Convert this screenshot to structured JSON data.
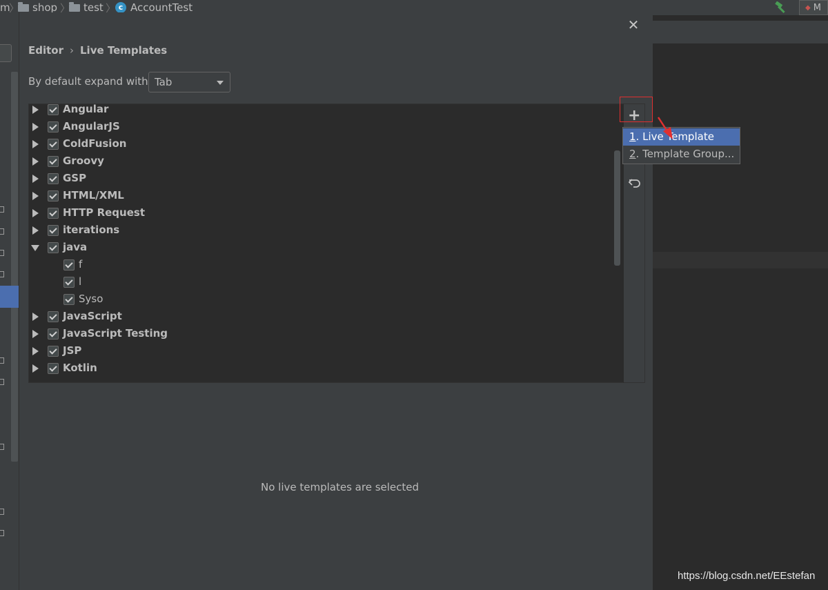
{
  "topbar": {
    "crumb_m": "m",
    "crumb_shop": "shop",
    "crumb_test": "test",
    "crumb_file": "AccountTest",
    "file_icon_letter": "c",
    "run_config": "M"
  },
  "dialog": {
    "breadcrumb_editor": "Editor",
    "breadcrumb_arrow": "›",
    "breadcrumb_page": "Live Templates",
    "close_glyph": "✕",
    "expand_label": "By default expand with",
    "expand_value": "Tab",
    "tree": [
      {
        "label": "Angular",
        "bold": true,
        "level": 0,
        "expanded": false,
        "checked": true
      },
      {
        "label": "AngularJS",
        "bold": true,
        "level": 0,
        "expanded": false,
        "checked": true
      },
      {
        "label": "ColdFusion",
        "bold": true,
        "level": 0,
        "expanded": false,
        "checked": true
      },
      {
        "label": "Groovy",
        "bold": true,
        "level": 0,
        "expanded": false,
        "checked": true
      },
      {
        "label": "GSP",
        "bold": true,
        "level": 0,
        "expanded": false,
        "checked": true
      },
      {
        "label": "HTML/XML",
        "bold": true,
        "level": 0,
        "expanded": false,
        "checked": true
      },
      {
        "label": "HTTP Request",
        "bold": true,
        "level": 0,
        "expanded": false,
        "checked": true
      },
      {
        "label": "iterations",
        "bold": true,
        "level": 0,
        "expanded": false,
        "checked": true
      },
      {
        "label": "java",
        "bold": true,
        "level": 0,
        "expanded": true,
        "checked": true
      },
      {
        "label": "f",
        "bold": false,
        "level": 1,
        "expanded": false,
        "checked": true
      },
      {
        "label": "l",
        "bold": false,
        "level": 1,
        "expanded": false,
        "checked": true
      },
      {
        "label": "Syso",
        "bold": false,
        "level": 1,
        "expanded": false,
        "checked": true
      },
      {
        "label": "JavaScript",
        "bold": true,
        "level": 0,
        "expanded": false,
        "checked": true
      },
      {
        "label": "JavaScript Testing",
        "bold": true,
        "level": 0,
        "expanded": false,
        "checked": true
      },
      {
        "label": "JSP",
        "bold": true,
        "level": 0,
        "expanded": false,
        "checked": true
      },
      {
        "label": "Kotlin",
        "bold": true,
        "level": 0,
        "expanded": false,
        "checked": true
      }
    ],
    "toolbar": {
      "add_glyph": "+"
    },
    "popup": [
      {
        "mnemonic": "1",
        "text": ". Live Template",
        "selected": true
      },
      {
        "mnemonic": "2",
        "text": ". Template Group...",
        "selected": false
      }
    ],
    "empty_detail": "No live templates are selected"
  },
  "watermark": "https://blog.csdn.net/EEstefan",
  "colors": {
    "background": "#3c3f41",
    "editor_background": "#2b2b2b",
    "selection": "#4b6eaf",
    "highlight_box": "#e03030",
    "text": "#bbbbbb"
  }
}
